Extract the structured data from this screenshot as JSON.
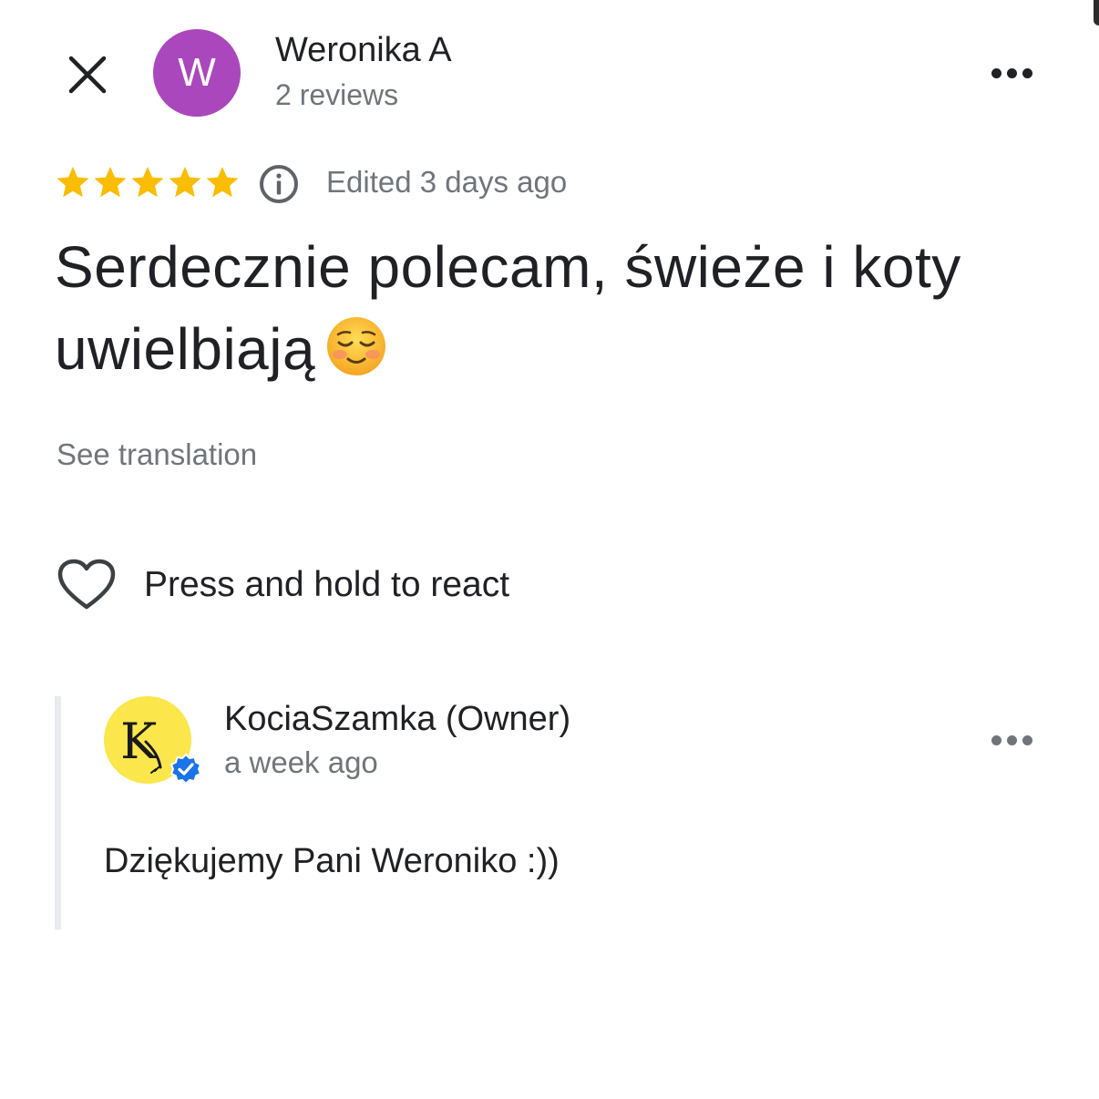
{
  "colors": {
    "star": "#fbbc04",
    "avatar_bg": "#ab47bc",
    "owner_avatar_bg": "#fbe64b",
    "verified": "#1a73e8",
    "secondary_text": "#70757a"
  },
  "header": {
    "close_icon": "close-icon",
    "reviewer": {
      "avatar_letter": "W",
      "name": "Weronika A",
      "review_count": "2 reviews"
    },
    "more_icon": "more-horizontal-icon"
  },
  "review": {
    "rating": 5,
    "max_rating": 5,
    "info_icon": "info-icon",
    "edited": "Edited 3 days ago",
    "text": "Serdecznie polecam, świeże i koty uwielbiają",
    "emoji": "smiling-face-icon",
    "see_translation": "See translation"
  },
  "reaction": {
    "icon": "heart-outline-icon",
    "label": "Press and hold to react"
  },
  "owner_response": {
    "avatar_letter": "K",
    "verified_icon": "verified-badge-icon",
    "name": "KociaSzamka (Owner)",
    "time": "a week ago",
    "text": "Dziękujemy Pani Weroniko :))",
    "more_icon": "more-horizontal-icon"
  }
}
